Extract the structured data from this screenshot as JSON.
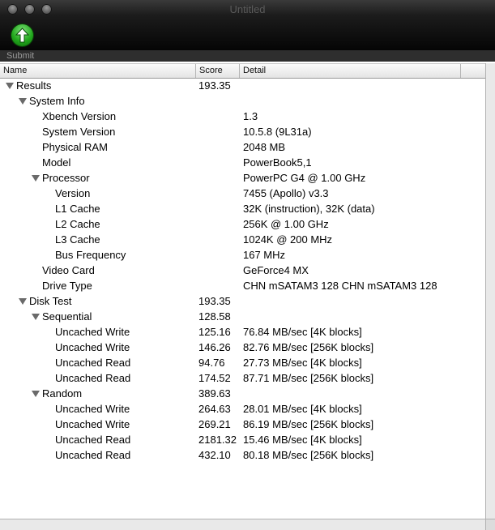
{
  "window": {
    "title": "Untitled"
  },
  "toolbar": {
    "submit_label": "Submit"
  },
  "columns": {
    "name": "Name",
    "score": "Score",
    "detail": "Detail"
  },
  "rows": [
    {
      "indent": 0,
      "tri": true,
      "name": "Results",
      "score": "193.35",
      "detail": ""
    },
    {
      "indent": 1,
      "tri": true,
      "name": "System Info",
      "score": "",
      "detail": ""
    },
    {
      "indent": 2,
      "tri": false,
      "name": "Xbench Version",
      "score": "",
      "detail": "1.3"
    },
    {
      "indent": 2,
      "tri": false,
      "name": "System Version",
      "score": "",
      "detail": "10.5.8 (9L31a)"
    },
    {
      "indent": 2,
      "tri": false,
      "name": "Physical RAM",
      "score": "",
      "detail": "2048 MB"
    },
    {
      "indent": 2,
      "tri": false,
      "name": "Model",
      "score": "",
      "detail": "PowerBook5,1"
    },
    {
      "indent": 2,
      "tri": true,
      "name": "Processor",
      "score": "",
      "detail": "PowerPC G4 @ 1.00 GHz"
    },
    {
      "indent": 3,
      "tri": false,
      "name": "Version",
      "score": "",
      "detail": "7455 (Apollo) v3.3"
    },
    {
      "indent": 3,
      "tri": false,
      "name": "L1 Cache",
      "score": "",
      "detail": "32K (instruction), 32K (data)"
    },
    {
      "indent": 3,
      "tri": false,
      "name": "L2 Cache",
      "score": "",
      "detail": "256K @ 1.00 GHz"
    },
    {
      "indent": 3,
      "tri": false,
      "name": "L3 Cache",
      "score": "",
      "detail": "1024K @ 200 MHz"
    },
    {
      "indent": 3,
      "tri": false,
      "name": "Bus Frequency",
      "score": "",
      "detail": "167 MHz"
    },
    {
      "indent": 2,
      "tri": false,
      "name": "Video Card",
      "score": "",
      "detail": "GeForce4 MX"
    },
    {
      "indent": 2,
      "tri": false,
      "name": "Drive Type",
      "score": "",
      "detail": "CHN mSATAM3 128 CHN mSATAM3 128"
    },
    {
      "indent": 1,
      "tri": true,
      "name": "Disk Test",
      "score": "193.35",
      "detail": ""
    },
    {
      "indent": 2,
      "tri": true,
      "name": "Sequential",
      "score": "128.58",
      "detail": ""
    },
    {
      "indent": 3,
      "tri": false,
      "name": "Uncached Write",
      "score": "125.16",
      "detail": "76.84 MB/sec [4K blocks]"
    },
    {
      "indent": 3,
      "tri": false,
      "name": "Uncached Write",
      "score": "146.26",
      "detail": "82.76 MB/sec [256K blocks]"
    },
    {
      "indent": 3,
      "tri": false,
      "name": "Uncached Read",
      "score": "94.76",
      "detail": "27.73 MB/sec [4K blocks]"
    },
    {
      "indent": 3,
      "tri": false,
      "name": "Uncached Read",
      "score": "174.52",
      "detail": "87.71 MB/sec [256K blocks]"
    },
    {
      "indent": 2,
      "tri": true,
      "name": "Random",
      "score": "389.63",
      "detail": ""
    },
    {
      "indent": 3,
      "tri": false,
      "name": "Uncached Write",
      "score": "264.63",
      "detail": "28.01 MB/sec [4K blocks]"
    },
    {
      "indent": 3,
      "tri": false,
      "name": "Uncached Write",
      "score": "269.21",
      "detail": "86.19 MB/sec [256K blocks]"
    },
    {
      "indent": 3,
      "tri": false,
      "name": "Uncached Read",
      "score": "2181.32",
      "detail": "15.46 MB/sec [4K blocks]"
    },
    {
      "indent": 3,
      "tri": false,
      "name": "Uncached Read",
      "score": "432.10",
      "detail": "80.18 MB/sec [256K blocks]"
    }
  ]
}
